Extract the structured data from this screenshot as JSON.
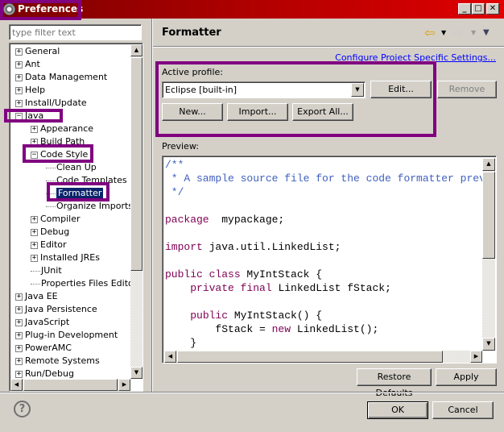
{
  "window": {
    "title": "Preferences",
    "minimize": "_",
    "maximize": "□",
    "close": "✕"
  },
  "filter": {
    "placeholder": "type filter text"
  },
  "tree": [
    {
      "label": "General",
      "level": 0,
      "toggle": "+"
    },
    {
      "label": "Ant",
      "level": 0,
      "toggle": "+"
    },
    {
      "label": "Data Management",
      "level": 0,
      "toggle": "+"
    },
    {
      "label": "Help",
      "level": 0,
      "toggle": "+"
    },
    {
      "label": "Install/Update",
      "level": 0,
      "toggle": "+"
    },
    {
      "label": "Java",
      "level": 0,
      "toggle": "-"
    },
    {
      "label": "Appearance",
      "level": 1,
      "toggle": "+"
    },
    {
      "label": "Build Path",
      "level": 1,
      "toggle": "+"
    },
    {
      "label": "Code Style",
      "level": 1,
      "toggle": "-"
    },
    {
      "label": "Clean Up",
      "level": 2,
      "toggle": ""
    },
    {
      "label": "Code Templates",
      "level": 2,
      "toggle": ""
    },
    {
      "label": "Formatter",
      "level": 2,
      "toggle": "",
      "selected": true
    },
    {
      "label": "Organize Imports",
      "level": 2,
      "toggle": ""
    },
    {
      "label": "Compiler",
      "level": 1,
      "toggle": "+"
    },
    {
      "label": "Debug",
      "level": 1,
      "toggle": "+"
    },
    {
      "label": "Editor",
      "level": 1,
      "toggle": "+"
    },
    {
      "label": "Installed JREs",
      "level": 1,
      "toggle": "+"
    },
    {
      "label": "JUnit",
      "level": 1,
      "toggle": ""
    },
    {
      "label": "Properties Files Editor",
      "level": 1,
      "toggle": ""
    },
    {
      "label": "Java EE",
      "level": 0,
      "toggle": "+"
    },
    {
      "label": "Java Persistence",
      "level": 0,
      "toggle": "+"
    },
    {
      "label": "JavaScript",
      "level": 0,
      "toggle": "+"
    },
    {
      "label": "Plug-in Development",
      "level": 0,
      "toggle": "+"
    },
    {
      "label": "PowerAMC",
      "level": 0,
      "toggle": "+"
    },
    {
      "label": "Remote Systems",
      "level": 0,
      "toggle": "+"
    },
    {
      "label": "Run/Debug",
      "level": 0,
      "toggle": "+"
    }
  ],
  "page": {
    "title": "Formatter",
    "configure_link": "Configure Project Specific Settings...",
    "active_profile_label": "Active profile:",
    "profile_value": "Eclipse [built-in]",
    "edit": "Edit...",
    "remove": "Remove",
    "new": "New...",
    "import": "Import...",
    "export_all": "Export All...",
    "preview_label": "Preview:",
    "restore_defaults": "Restore Defaults",
    "apply": "Apply"
  },
  "preview_code": [
    [
      [
        "cm",
        "/**"
      ]
    ],
    [
      [
        "cm",
        " * A sample source file for the code formatter preview"
      ]
    ],
    [
      [
        "cm",
        " */"
      ]
    ],
    [],
    [
      [
        "kw",
        "package"
      ],
      [
        "",
        "  mypackage;"
      ]
    ],
    [],
    [
      [
        "kw",
        "import"
      ],
      [
        "",
        " java.util.LinkedList;"
      ]
    ],
    [],
    [
      [
        "kw",
        "public class"
      ],
      [
        "",
        " MyIntStack {"
      ]
    ],
    [
      [
        "",
        "    "
      ],
      [
        "kw",
        "private final"
      ],
      [
        "",
        " LinkedList fStack;"
      ]
    ],
    [],
    [
      [
        "",
        "    "
      ],
      [
        "kw",
        "public"
      ],
      [
        "",
        " MyIntStack() {"
      ]
    ],
    [
      [
        "",
        "        fStack = "
      ],
      [
        "kw",
        "new"
      ],
      [
        "",
        " LinkedList();"
      ]
    ],
    [
      [
        "",
        "    }"
      ]
    ]
  ],
  "footer": {
    "ok": "OK",
    "cancel": "Cancel",
    "help": "?"
  },
  "colors": {
    "highlight": "#800080",
    "selection": "#0a246a",
    "comment": "#3f5fbf",
    "keyword": "#7f0055",
    "link": "#0000ff"
  }
}
